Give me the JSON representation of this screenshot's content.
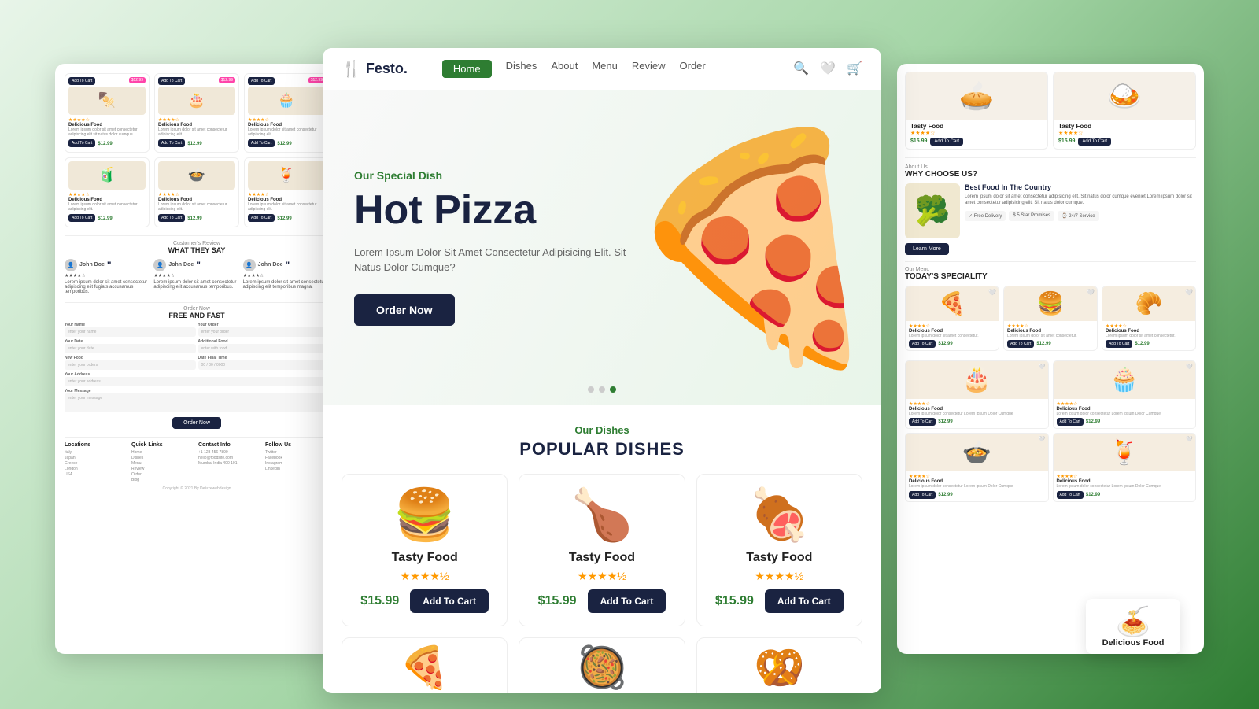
{
  "app": {
    "name": "Festo.",
    "logo_icon": "🍴"
  },
  "nav": {
    "links": [
      "Home",
      "Dishes",
      "About",
      "Menu",
      "Review",
      "Order"
    ],
    "active": "Home"
  },
  "hero": {
    "tag": "Our Special Dish",
    "title": "Hot Pizza",
    "description": "Lorem Ipsum Dolor Sit Amet Consectetur Adipisicing Elit. Sit Natus Dolor Cumque?",
    "cta": "Order Now",
    "dots": [
      1,
      2,
      3
    ],
    "active_dot": 2
  },
  "dishes_section": {
    "tag": "Our Dishes",
    "title": "POPULAR DISHES",
    "items": [
      {
        "name": "Tasty Food",
        "emoji": "🍔",
        "stars": "★★★★½",
        "price": "$15.99",
        "cta": "Add To Cart"
      },
      {
        "name": "Tasty Food",
        "emoji": "🍗",
        "stars": "★★★★½",
        "price": "$15.99",
        "cta": "Add To Cart"
      },
      {
        "name": "Tasty Food",
        "emoji": "🍖",
        "stars": "★★★★½",
        "price": "$15.99",
        "cta": "Add To Cart"
      }
    ],
    "second_row": [
      {
        "emoji": "🍕"
      },
      {
        "emoji": "🥘"
      },
      {
        "emoji": "🥨"
      }
    ]
  },
  "left_panel": {
    "products": [
      {
        "name": "Delicious Food",
        "price": "$12.99",
        "emoji": "🍢"
      },
      {
        "name": "Delicious Food",
        "price": "$12.99",
        "emoji": "🎂"
      },
      {
        "name": "Delicious Food",
        "price": "$12.99",
        "emoji": "🧁"
      },
      {
        "name": "Delicious Food",
        "price": "$12.99",
        "emoji": "🧃"
      },
      {
        "name": "Delicious Food",
        "price": "$12.99",
        "emoji": "🍲"
      },
      {
        "name": "Delicious Food",
        "price": "$12.99",
        "emoji": "🍹"
      }
    ],
    "reviews": {
      "tag": "Customer's Review",
      "heading": "WHAT THEY SAY",
      "items": [
        {
          "reviewer": "John Doe",
          "text": "Lorem ipsum dolor sit amet consectetur adipiscing elit."
        },
        {
          "reviewer": "John Doe",
          "text": "Lorem ipsum dolor sit amet consectetur adipiscing elit."
        },
        {
          "reviewer": "John Doe",
          "text": "Lorem ipsum dolor sit amet consectetur adipiscing elit."
        }
      ]
    },
    "order_form": {
      "tag": "Order Now",
      "heading": "FREE AND FAST",
      "fields": [
        "Your Name",
        "Your Order",
        "Date",
        "Additional Food",
        "New Food",
        "Date Final Time",
        "Your Address",
        "Your Message"
      ],
      "cta": "Order Now"
    },
    "footer": {
      "columns": [
        {
          "title": "Locations",
          "items": [
            "Italy",
            "Japan",
            "Greece",
            "London",
            "USA"
          ]
        },
        {
          "title": "Quick Links",
          "items": [
            "Home",
            "Dishes",
            "Menu",
            "Review",
            "Order",
            "Blog"
          ]
        },
        {
          "title": "Contact Info",
          "items": [
            "+1 123 456 7890",
            "hello@foodsite.com",
            "Mumbai India 400 101"
          ]
        },
        {
          "title": "Follow Us",
          "items": [
            "Twitter",
            "Facebook",
            "Instagram",
            "LinkedIn"
          ]
        }
      ],
      "copyright": "Copyright © 2021 By Deluxewebdesign"
    }
  },
  "right_panel": {
    "top_foods": [
      {
        "name": "Tasty Food",
        "price": "$15.99",
        "emoji": "🥧",
        "cta": "Add To Cart"
      },
      {
        "name": "Tasty Food",
        "price": "$15.99",
        "emoji": "🍛",
        "cta": "Add To Cart"
      }
    ],
    "why_choose": {
      "tag": "About Us",
      "heading": "WHY CHOOSE US?",
      "title": "Best Food In The Country",
      "desc": "Lorem ipsum dolor sit amet consectetur adipisicing elit. Sit natus dolor cumque eveniet Lorem ipsum dolor sit amet consectetur adipisicing elit. Sit natus dolor cumque.",
      "features": [
        "Free Delivery",
        "5 Star Promises",
        "24/7 Service"
      ],
      "cta": "Learn More"
    },
    "speciality": {
      "tag": "Our Menu",
      "heading": "TODAY'S SPECIALITY",
      "items": [
        {
          "name": "Delicious Food",
          "price": "$12.99",
          "emoji": "🍕"
        },
        {
          "name": "Delicious Food",
          "price": "$12.99",
          "emoji": "🍔"
        },
        {
          "name": "Delicious Food",
          "price": "$12.99",
          "emoji": "🥐"
        }
      ]
    },
    "product_rows": [
      {
        "name": "Delicious Food",
        "price": "$12.99",
        "emoji": "🎂"
      },
      {
        "name": "Delicious Food",
        "price": "$12.99",
        "emoji": "🧁"
      },
      {
        "name": "Delicious Food",
        "price": "$12.99",
        "emoji": "🍲"
      },
      {
        "name": "Delicious Food",
        "price": "$12.99",
        "emoji": "🍹"
      }
    ]
  },
  "delicious_card": {
    "title": "Delicious Food",
    "emoji": "🍝"
  }
}
